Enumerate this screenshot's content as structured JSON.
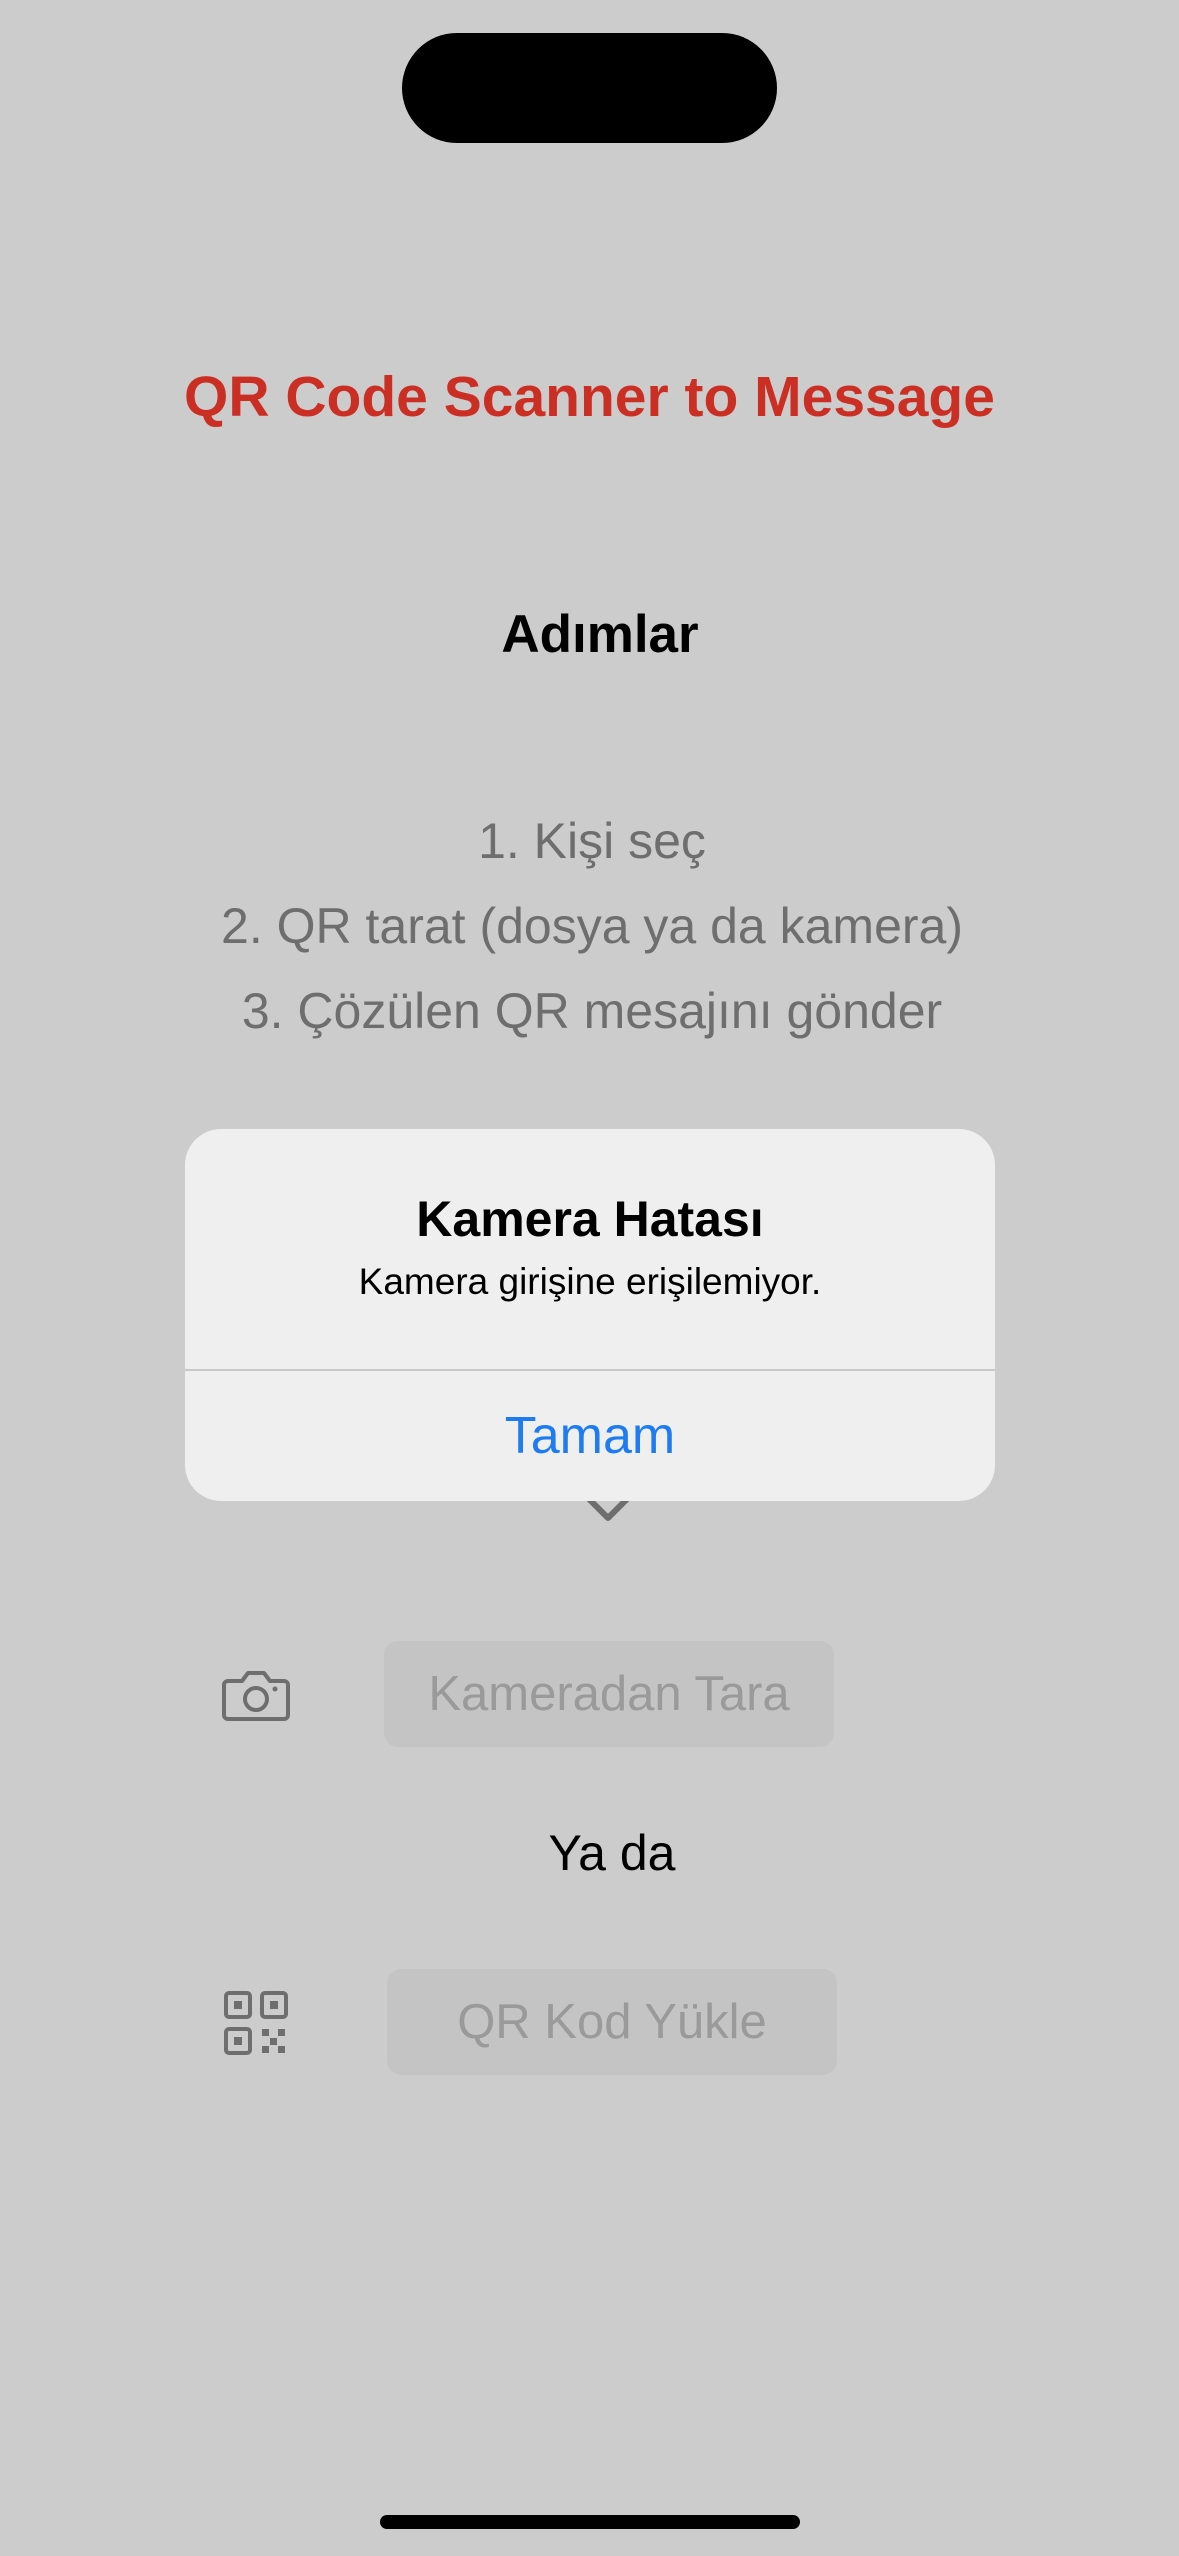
{
  "app": {
    "title": "QR Code Scanner to Message"
  },
  "steps": {
    "heading": "Adımlar",
    "items": [
      "1. Kişi seç",
      "2. QR tarat (dosya ya da kamera)",
      "3. Çözülen QR mesajını gönder"
    ]
  },
  "actions": {
    "camera_button": "Kameradan Tara",
    "or_text": "Ya da",
    "qr_upload_button": "QR Kod Yükle",
    "camera_icon": "camera-icon",
    "qr_icon": "qr-code-icon"
  },
  "alert": {
    "title": "Kamera Hatası",
    "message": "Kamera girişine erişilemiyor.",
    "ok_button": "Tamam"
  },
  "colors": {
    "title_red": "#cb2f24",
    "alert_button_blue": "#1f7cf0",
    "background": "#cccccc"
  }
}
